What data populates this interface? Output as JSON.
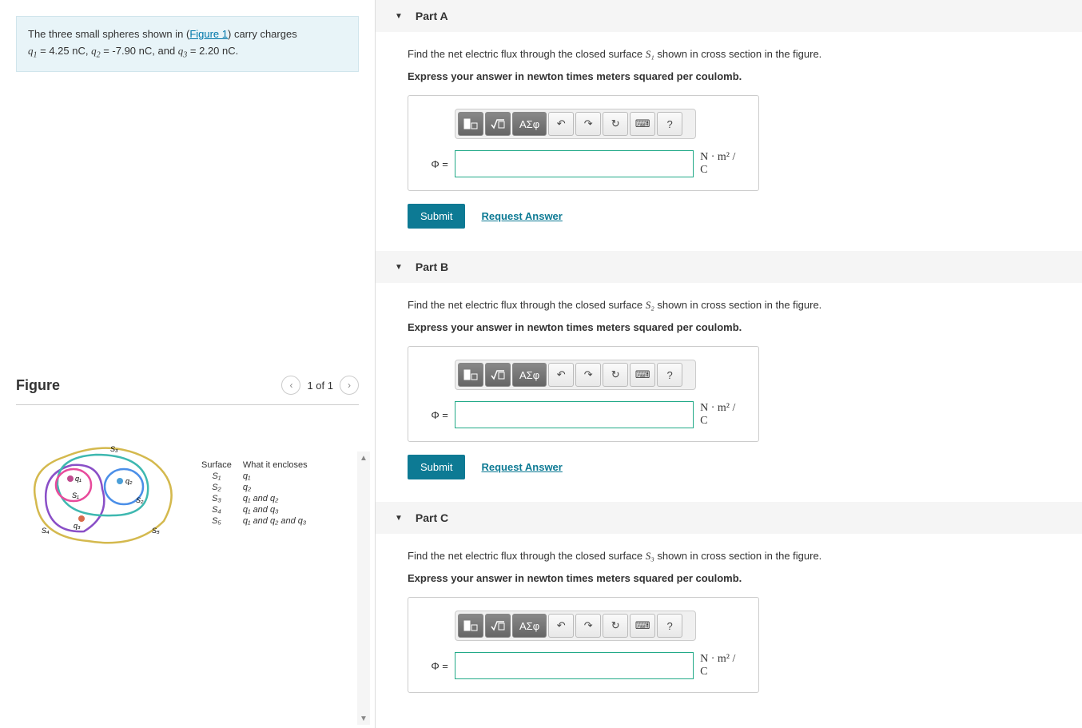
{
  "problem": {
    "intro_pre": "The three small spheres shown in (",
    "figure_link": "Figure 1",
    "intro_post": ") carry charges",
    "charges_line_q1": "q",
    "q1_val": " = 4.25 nC, ",
    "q2_lbl": "q",
    "q2_val": " = -7.90 nC, and ",
    "q3_lbl": "q",
    "q3_val": " = 2.20 nC."
  },
  "figure": {
    "title": "Figure",
    "pager": "1 of 1",
    "table_header_surface": "Surface",
    "table_header_encloses": "What it encloses",
    "rows": [
      {
        "s": "S₁",
        "e": "q₁"
      },
      {
        "s": "S₂",
        "e": "q₂"
      },
      {
        "s": "S₃",
        "e": "q₁ and q₂"
      },
      {
        "s": "S₄",
        "e": "q₁ and q₃"
      },
      {
        "s": "S₅",
        "e": "q₁ and q₂ and q₃"
      }
    ],
    "labels": {
      "q1": "q₁",
      "q2": "q₂",
      "q3": "q₃",
      "S1": "S₁",
      "S2": "S₂",
      "S3": "S₃",
      "S4": "S₄",
      "S5": "S₅"
    }
  },
  "parts": [
    {
      "title": "Part A",
      "surface": "S₁",
      "question_pre": "Find the net electric flux through the closed surface ",
      "question_post": " shown in cross section in the figure.",
      "instruction": "Express your answer in newton times meters squared per coulomb.",
      "phi_label": "Φ =",
      "units": "N · m² / C",
      "submit": "Submit",
      "request": "Request Answer"
    },
    {
      "title": "Part B",
      "surface": "S₂",
      "question_pre": "Find the net electric flux through the closed surface ",
      "question_post": " shown in cross section in the figure.",
      "instruction": "Express your answer in newton times meters squared per coulomb.",
      "phi_label": "Φ =",
      "units": "N · m² / C",
      "submit": "Submit",
      "request": "Request Answer"
    },
    {
      "title": "Part C",
      "surface": "S₃",
      "question_pre": "Find the net electric flux through the closed surface ",
      "question_post": " shown in cross section in the figure.",
      "instruction": "Express your answer in newton times meters squared per coulomb.",
      "phi_label": "Φ =",
      "units": "N · m² / C",
      "submit": "Submit",
      "request": "Request Answer"
    }
  ],
  "toolbar": {
    "template": "template-icon",
    "sqrt": "sqrt-icon",
    "greek": "ΑΣφ",
    "undo": "↶",
    "redo": "↷",
    "reset": "↻",
    "keyboard": "⌨",
    "help": "?"
  }
}
